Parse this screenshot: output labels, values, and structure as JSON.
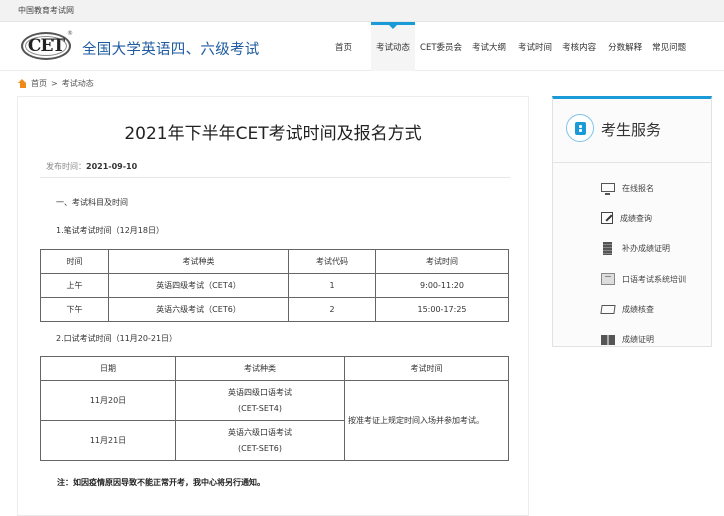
{
  "topbar": {
    "site_name": "中国教育考试网"
  },
  "header": {
    "logo_text": "CET",
    "logo_reg": "®",
    "site_title": "全国大学英语四、六级考试",
    "nav": [
      {
        "label": "首页",
        "active": false
      },
      {
        "label": "考试动态",
        "active": true
      },
      {
        "label": "CET委员会",
        "active": false
      },
      {
        "label": "考试大纲",
        "active": false
      },
      {
        "label": "考试时间",
        "active": false
      },
      {
        "label": "考核内容",
        "active": false
      },
      {
        "label": "分数解释",
        "active": false
      },
      {
        "label": "常见问题",
        "active": false
      }
    ]
  },
  "breadcrumb": {
    "home": "首页",
    "separator": ">",
    "current": "考试动态"
  },
  "article": {
    "title": "2021年下半年CET考试时间及报名方式",
    "pubdate_label": "发布时间：",
    "pubdate": "2021-09-10",
    "section1": "一、考试科目及时间",
    "written_heading": "1.笔试考试时间（12月18日）",
    "written_table": {
      "headers": [
        "时间",
        "考试种类",
        "考试代码",
        "考试时间"
      ],
      "rows": [
        [
          "上午",
          "英语四级考试（CET4）",
          "1",
          "9:00-11:20"
        ],
        [
          "下午",
          "英语六级考试（CET6）",
          "2",
          "15:00-17:25"
        ]
      ]
    },
    "oral_heading": "2.口试考试时间（11月20-21日）",
    "oral_table": {
      "headers": [
        "日期",
        "考试种类",
        "考试时间"
      ],
      "rows": [
        {
          "date": "11月20日",
          "type_line1": "英语四级口语考试",
          "type_line2": "(CET-SET4)"
        },
        {
          "date": "11月21日",
          "type_line1": "英语六级口语考试",
          "type_line2": "(CET-SET6)"
        }
      ],
      "time_note": "按准考证上规定时间入场并参加考试。"
    },
    "note": "注：如因疫情原因导致不能正常开考，我中心将另行通知。"
  },
  "sidebar": {
    "title": "考生服务",
    "items": [
      {
        "label": "在线报名",
        "icon": "monitor-icon"
      },
      {
        "label": "成绩查询",
        "icon": "edit-icon"
      },
      {
        "label": "补办成绩证明",
        "icon": "notebook-icon"
      },
      {
        "label": "口语考试系统培训",
        "icon": "screen-icon"
      },
      {
        "label": "成绩核查",
        "icon": "folder-icon"
      },
      {
        "label": "成绩证明",
        "icon": "book-icon"
      }
    ]
  },
  "colors": {
    "accent": "#1a9ad6",
    "title_blue": "#1d5aa0",
    "home_orange": "#f08a17"
  }
}
